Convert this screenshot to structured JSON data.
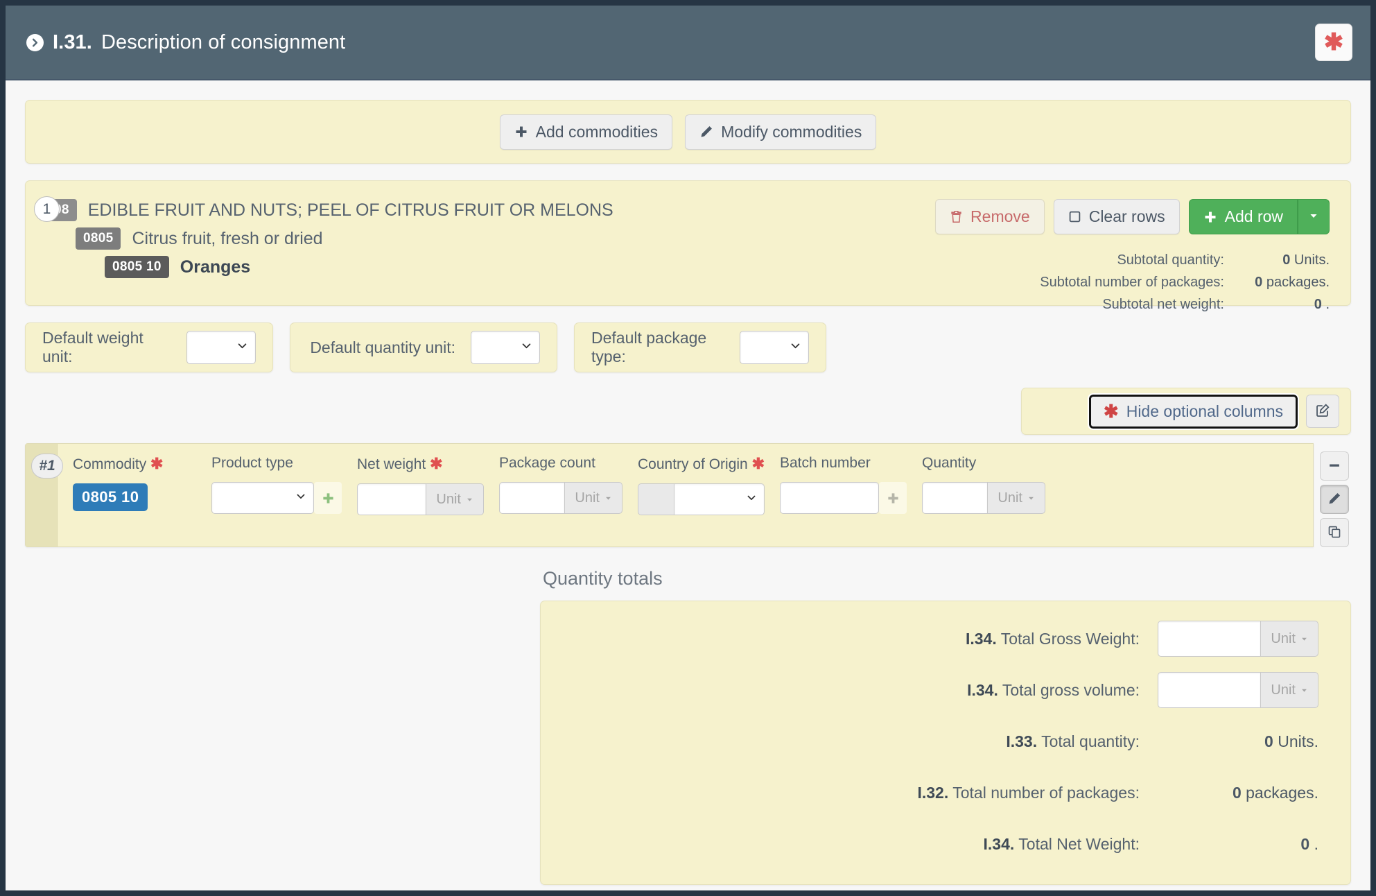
{
  "header": {
    "title_code": "I.31.",
    "title_text": "Description of consignment",
    "chevron_icon": "chevron-right-circle-icon",
    "required_icon": "asterisk-icon"
  },
  "commodity_actions": {
    "add_label": "Add commodities",
    "add_icon": "plus-icon",
    "modify_label": "Modify commodities",
    "modify_icon": "pencil-icon"
  },
  "commodity": {
    "index": "1",
    "levels": [
      {
        "code": "08",
        "text": "EDIBLE FRUIT AND NUTS; PEEL OF CITRUS FRUIT OR MELONS"
      },
      {
        "code": "0805",
        "text": "Citrus fruit, fresh or dried"
      },
      {
        "code": "0805 10",
        "text": "Oranges"
      }
    ],
    "buttons": {
      "remove_label": "Remove",
      "remove_icon": "trash-icon",
      "clear_label": "Clear rows",
      "clear_icon": "square-icon",
      "add_row_label": "Add row",
      "add_row_icon": "plus-icon",
      "add_row_caret_icon": "caret-down-icon"
    },
    "subtotals": [
      {
        "label": "Subtotal quantity:",
        "value": "0",
        "unit": "Units."
      },
      {
        "label": "Subtotal number of packages:",
        "value": "0",
        "unit": "packages."
      },
      {
        "label": "Subtotal net weight:",
        "value": "0",
        "unit": "."
      }
    ]
  },
  "defaults": [
    {
      "label": "Default weight unit:",
      "value": ""
    },
    {
      "label": "Default quantity unit:",
      "value": ""
    },
    {
      "label": "Default package type:",
      "value": ""
    }
  ],
  "optional_columns": {
    "toggle_label": "Hide optional columns",
    "toggle_icon": "asterisk-icon",
    "edit_icon": "edit-square-icon"
  },
  "table": {
    "row_index": "#1",
    "columns": [
      {
        "header": "Commodity",
        "required": true
      },
      {
        "header": "Product type",
        "required": false
      },
      {
        "header": "Net weight",
        "required": true
      },
      {
        "header": "Package count",
        "required": false
      },
      {
        "header": "Country of Origin",
        "required": true
      },
      {
        "header": "Batch number",
        "required": false
      },
      {
        "header": "Quantity",
        "required": false
      }
    ],
    "row": {
      "commodity_code": "0805 10",
      "product_type_value": "",
      "product_type_add_icon": "plus-icon",
      "net_weight_value": "",
      "net_weight_unit": "Unit",
      "package_count_value": "",
      "package_count_unit": "Unit",
      "country_of_origin_value": "",
      "batch_number_value": "",
      "batch_add_icon": "plus-icon",
      "quantity_value": "",
      "quantity_unit": "Unit"
    },
    "side_buttons": [
      {
        "icon": "minus-icon",
        "name": "remove-row-button"
      },
      {
        "icon": "pencil-icon",
        "name": "edit-row-button"
      },
      {
        "icon": "copy-icon",
        "name": "duplicate-row-button"
      }
    ]
  },
  "quantity_totals": {
    "title": "Quantity totals",
    "rows": [
      {
        "code": "I.34.",
        "label": "Total Gross Weight:",
        "type": "input",
        "value": "",
        "unit": "Unit"
      },
      {
        "code": "I.34.",
        "label": "Total gross volume:",
        "type": "input",
        "value": "",
        "unit": "Unit"
      },
      {
        "code": "I.33.",
        "label": "Total quantity:",
        "type": "static",
        "value": "0",
        "unit": "Units."
      },
      {
        "code": "I.32.",
        "label": "Total number of packages:",
        "type": "static",
        "value": "0",
        "unit": "packages."
      },
      {
        "code": "I.34.",
        "label": "Total Net Weight:",
        "type": "static",
        "value": "0",
        "unit": "."
      }
    ]
  },
  "colors": {
    "header_bg": "#526673",
    "panel_yellow": "#f6f2cd",
    "accent_green": "#4fb05a",
    "accent_blue": "#2e7cb8",
    "required_red": "#e05050",
    "page_border": "#263544"
  }
}
